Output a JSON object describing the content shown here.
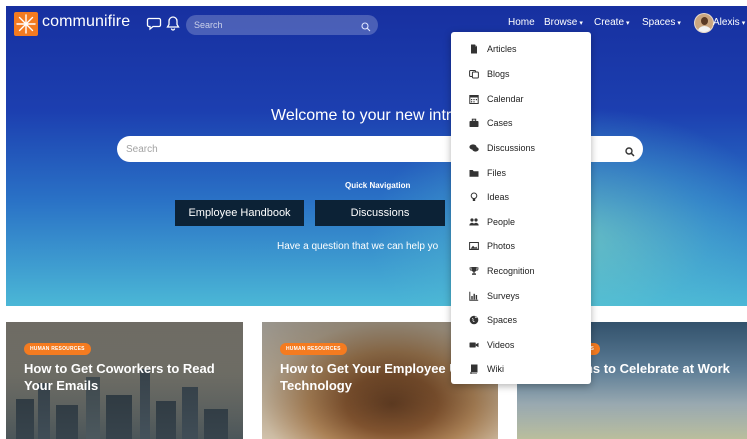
{
  "brand": {
    "name": "communifire"
  },
  "nav": {
    "search_placeholder": "Search",
    "links": {
      "home": "Home",
      "browse": "Browse",
      "create": "Create",
      "spaces": "Spaces",
      "user": "Alexis"
    },
    "caret": "▾"
  },
  "hero": {
    "welcome": "Welcome to your new intr",
    "search_placeholder": "Search",
    "quick_nav_label": "Quick Navigation",
    "buttons": [
      "Employee Handbook",
      "Discussions"
    ],
    "question": "Have a question that we can help yo"
  },
  "browse_menu": {
    "items": [
      {
        "label": "Articles",
        "icon": "document-icon"
      },
      {
        "label": "Blogs",
        "icon": "blogs-icon"
      },
      {
        "label": "Calendar",
        "icon": "calendar-icon"
      },
      {
        "label": "Cases",
        "icon": "briefcase-icon"
      },
      {
        "label": "Discussions",
        "icon": "chat-bubbles-icon"
      },
      {
        "label": "Files",
        "icon": "folder-icon"
      },
      {
        "label": "Ideas",
        "icon": "lightbulb-icon"
      },
      {
        "label": "People",
        "icon": "people-icon"
      },
      {
        "label": "Photos",
        "icon": "image-icon"
      },
      {
        "label": "Recognition",
        "icon": "trophy-icon"
      },
      {
        "label": "Surveys",
        "icon": "bar-chart-icon"
      },
      {
        "label": "Spaces",
        "icon": "globe-icon"
      },
      {
        "label": "Videos",
        "icon": "video-camera-icon"
      },
      {
        "label": "Wiki",
        "icon": "book-icon"
      }
    ]
  },
  "cards": [
    {
      "badge": "HUMAN RESOURCES",
      "title": "How to Get Coworkers to Read Your Emails"
    },
    {
      "badge": "HUMAN RESOURCES",
      "title": "How to Get Your Employee Use Technology"
    },
    {
      "badge": "ES",
      "title": "ons to Celebrate at Work"
    }
  ],
  "colors": {
    "accent": "#f47b20",
    "hero_top": "#1730a0",
    "hero_bottom": "#4bb7d6",
    "dark_button": "#0c2236"
  }
}
